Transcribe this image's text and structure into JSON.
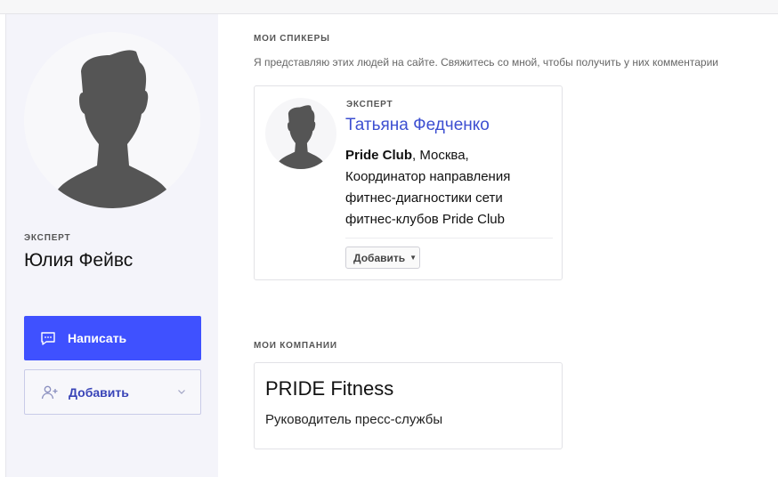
{
  "profile": {
    "role": "ЭКСПЕРТ",
    "name": "Юлия Фейвс",
    "write_label": "Написать",
    "add_label": "Добавить"
  },
  "speakers": {
    "title": "МОИ СПИКЕРЫ",
    "description": "Я представляю этих людей на сайте. Свяжитесь со мной, чтобы получить у них комментарии",
    "items": [
      {
        "role": "ЭКСПЕРТ",
        "name": "Татьяна Федченко",
        "company": "Pride Club",
        "details": ", Москва, Координатор направления фитнес-диагностики сети фитнес-клубов Pride Club",
        "add_label": "Добавить"
      }
    ]
  },
  "companies": {
    "title": "МОИ КОМПАНИИ",
    "items": [
      {
        "name": "PRIDE Fitness",
        "position": "Руководитель пресс-службы"
      }
    ]
  },
  "colors": {
    "accent": "#3f51ff",
    "link": "#3d4fd1",
    "sidebar_bg": "#f4f4fa",
    "silhouette": "#555555"
  }
}
